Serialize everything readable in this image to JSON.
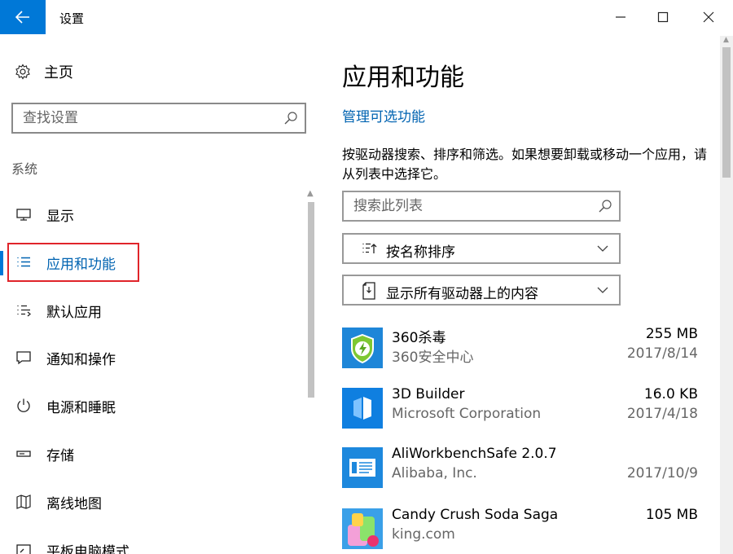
{
  "window": {
    "title": "设置",
    "back_icon": "arrow-left-icon",
    "minimize_icon": "minimize-icon",
    "maximize_icon": "maximize-icon",
    "close_icon": "close-icon",
    "accent_color": "#0078d7"
  },
  "sidebar": {
    "home_label": "主页",
    "home_icon": "gear-icon",
    "search_placeholder": "查找设置",
    "search_icon": "search-icon",
    "section_label": "系统",
    "items": [
      {
        "label": "显示",
        "icon": "monitor-icon",
        "selected": false
      },
      {
        "label": "应用和功能",
        "icon": "list-icon",
        "selected": true
      },
      {
        "label": "默认应用",
        "icon": "default-apps-icon",
        "selected": false
      },
      {
        "label": "通知和操作",
        "icon": "notification-icon",
        "selected": false
      },
      {
        "label": "电源和睡眠",
        "icon": "power-icon",
        "selected": false
      },
      {
        "label": "存储",
        "icon": "storage-icon",
        "selected": false
      },
      {
        "label": "离线地图",
        "icon": "map-icon",
        "selected": false
      },
      {
        "label": "平板电脑模式",
        "icon": "tablet-icon",
        "selected": false
      }
    ],
    "highlight_color": "#e0242a"
  },
  "main": {
    "title": "应用和功能",
    "manage_link": "管理可选功能",
    "description": "按驱动器搜索、排序和筛选。如果想要卸载或移动一个应用，请从列表中选择它。",
    "search_placeholder": "搜索此列表",
    "sort_label": "按名称排序",
    "filter_label": "显示所有驱动器上的内容",
    "link_color": "#0063b1",
    "apps": [
      {
        "name": "360杀毒",
        "publisher": "360安全中心",
        "size": "255 MB",
        "date": "2017/8/14",
        "icon": "shield-app-icon"
      },
      {
        "name": "3D Builder",
        "publisher": "Microsoft Corporation",
        "size": "16.0 KB",
        "date": "2017/4/18",
        "icon": "builder-app-icon"
      },
      {
        "name": "AliWorkbenchSafe 2.0.7",
        "publisher": "Alibaba, Inc.",
        "size": "",
        "date": "2017/10/9",
        "icon": "window-app-icon"
      },
      {
        "name": "Candy Crush Soda Saga",
        "publisher": "king.com",
        "size": "105 MB",
        "date": "",
        "icon": "candy-app-icon"
      }
    ]
  }
}
